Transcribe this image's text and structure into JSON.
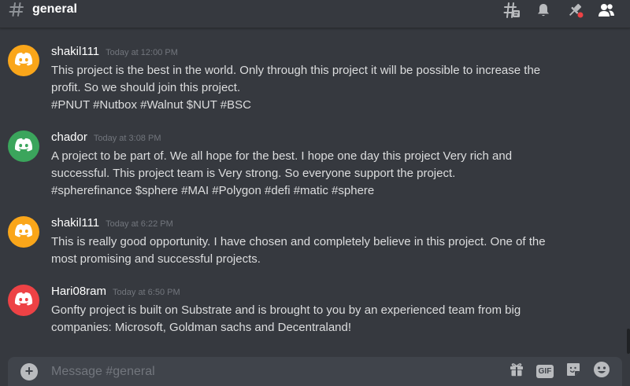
{
  "channel": {
    "name": "general"
  },
  "header_tools": [
    {
      "icon": "threads-icon"
    },
    {
      "icon": "bell-icon"
    },
    {
      "icon": "pin-icon"
    },
    {
      "icon": "members-icon"
    }
  ],
  "messages": [
    {
      "username": "shakil111",
      "timestamp": "Today at 12:00 PM",
      "avatar_color": "#faa61a",
      "lines": [
        "This project is the best in the world. Only through this project it will be possible to increase the",
        "profit. So we should join this project.",
        "#PNUT #Nutbox #Walnut $NUT #BSC"
      ]
    },
    {
      "username": "chador",
      "timestamp": "Today at 3:08 PM",
      "avatar_color": "#3ba55c",
      "lines": [
        "A  project to be part of. We all hope for the best. I hope one day this project Very rich and",
        "successful. This project team is Very strong. So everyone support the project.",
        "#spherefinance $sphere #MAI #Polygon #defi #matic #sphere"
      ]
    },
    {
      "username": "shakil111",
      "timestamp": "Today at 6:22 PM",
      "avatar_color": "#faa61a",
      "lines": [
        "This is really good opportunity. I have chosen and completely believe in this project. One of the",
        "most promising and successful projects."
      ]
    },
    {
      "username": "Hari08ram",
      "timestamp": "Today at 6:50 PM",
      "avatar_color": "#ed4245",
      "lines": [
        "Gonfty project is built on Substrate and is brought to you by an experienced team from big",
        "companies: Microsoft, Goldman sachs and Decentraland!"
      ]
    }
  ],
  "composer": {
    "placeholder": "Message #general",
    "gif_label": "GIF"
  },
  "colors": {
    "background": "#36393f",
    "input": "#40444b",
    "pin_dot": "#ed4245"
  }
}
